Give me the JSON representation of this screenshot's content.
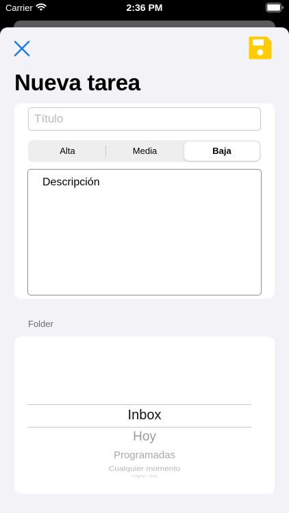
{
  "status_bar": {
    "carrier": "Carrier",
    "time": "2:36 PM"
  },
  "header": {
    "title": "Nueva tarea",
    "close_icon": "close-x",
    "save_icon": "floppy-disk",
    "close_color": "#1f7fe3",
    "save_color": "#ffcc00"
  },
  "form": {
    "title_placeholder": "Título",
    "title_value": "",
    "priority": {
      "options": [
        "Alta",
        "Media",
        "Baja"
      ],
      "selected": "Baja"
    },
    "description_placeholder": "Descripción",
    "description_value": ""
  },
  "folder": {
    "label": "Folder",
    "options": [
      "Inbox",
      "Hoy",
      "Programadas",
      "Cualquier momento",
      "Algún día"
    ],
    "selected": "Inbox"
  }
}
